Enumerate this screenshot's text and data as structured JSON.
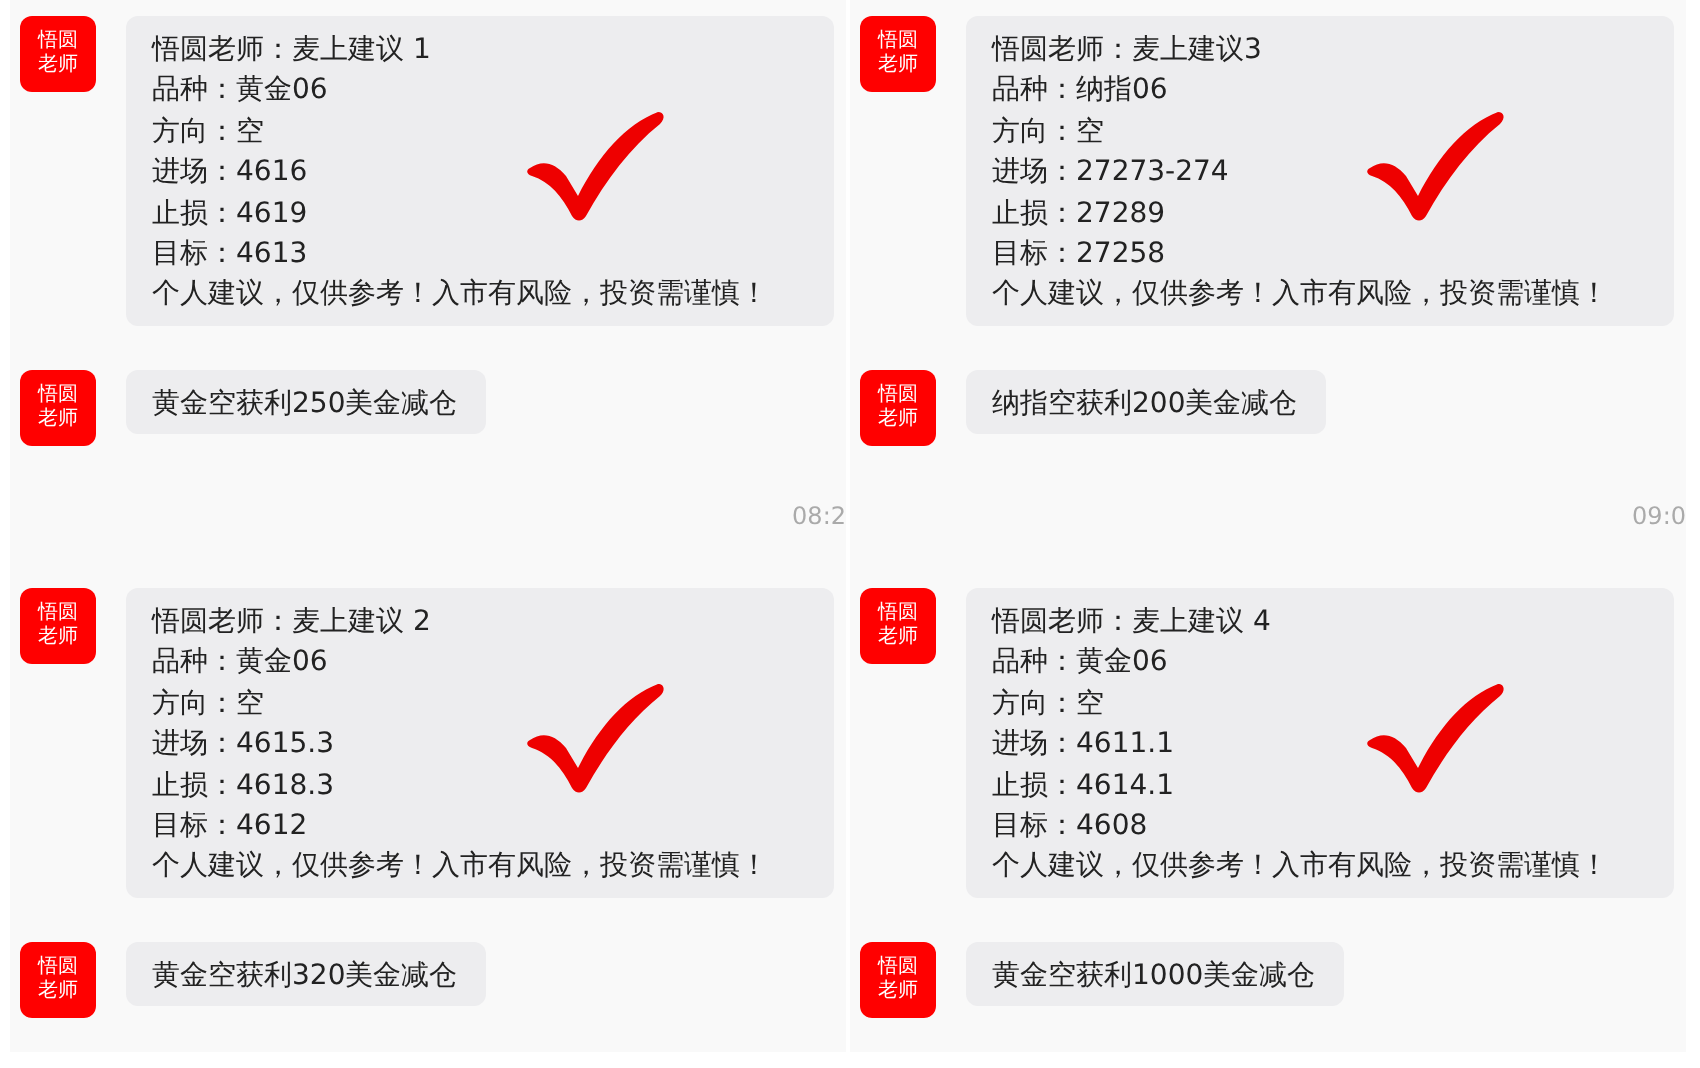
{
  "panels": [
    {
      "messages": [
        {
          "avatar": [
            "悟圆",
            "老师"
          ],
          "lines": [
            "悟圆老师：麦上建议 1",
            "品种：黄金06",
            "方向：空",
            "进场：4616",
            "止损：4619",
            "目标：4613",
            "个人建议，仅供参考！入市有风险，投资需谨慎！"
          ],
          "checked": true
        },
        {
          "avatar": [
            "悟圆",
            "老师"
          ],
          "lines": [
            "黄金空获利250美金减仓"
          ]
        }
      ],
      "time": "08:2"
    },
    {
      "messages": [
        {
          "avatar": [
            "悟圆",
            "老师"
          ],
          "lines": [
            "悟圆老师：麦上建议3",
            "品种：纳指06",
            "方向：空",
            "进场：27273-274",
            "止损：27289",
            "目标：27258",
            "个人建议，仅供参考！入市有风险，投资需谨慎！"
          ],
          "checked": true
        },
        {
          "avatar": [
            "悟圆",
            "老师"
          ],
          "lines": [
            "纳指空获利200美金减仓"
          ]
        }
      ],
      "time": "09:0"
    },
    {
      "messages": [
        {
          "avatar": [
            "悟圆",
            "老师"
          ],
          "lines": [
            "悟圆老师：麦上建议 2",
            "品种：黄金06",
            "方向：空",
            "进场：4615.3",
            "止损：4618.3",
            "目标：4612",
            "个人建议，仅供参考！入市有风险，投资需谨慎！"
          ],
          "checked": true
        },
        {
          "avatar": [
            "悟圆",
            "老师"
          ],
          "lines": [
            "黄金空获利320美金减仓"
          ]
        }
      ]
    },
    {
      "messages": [
        {
          "avatar": [
            "悟圆",
            "老师"
          ],
          "lines": [
            "悟圆老师：麦上建议 4",
            "品种：黄金06",
            "方向：空",
            "进场：4611.1",
            "止损：4614.1",
            "目标：4608",
            "个人建议，仅供参考！入市有风险，投资需谨慎！"
          ],
          "checked": true
        },
        {
          "avatar": [
            "悟圆",
            "老师"
          ],
          "lines": [
            "黄金空获利1000美金减仓"
          ]
        }
      ]
    }
  ]
}
